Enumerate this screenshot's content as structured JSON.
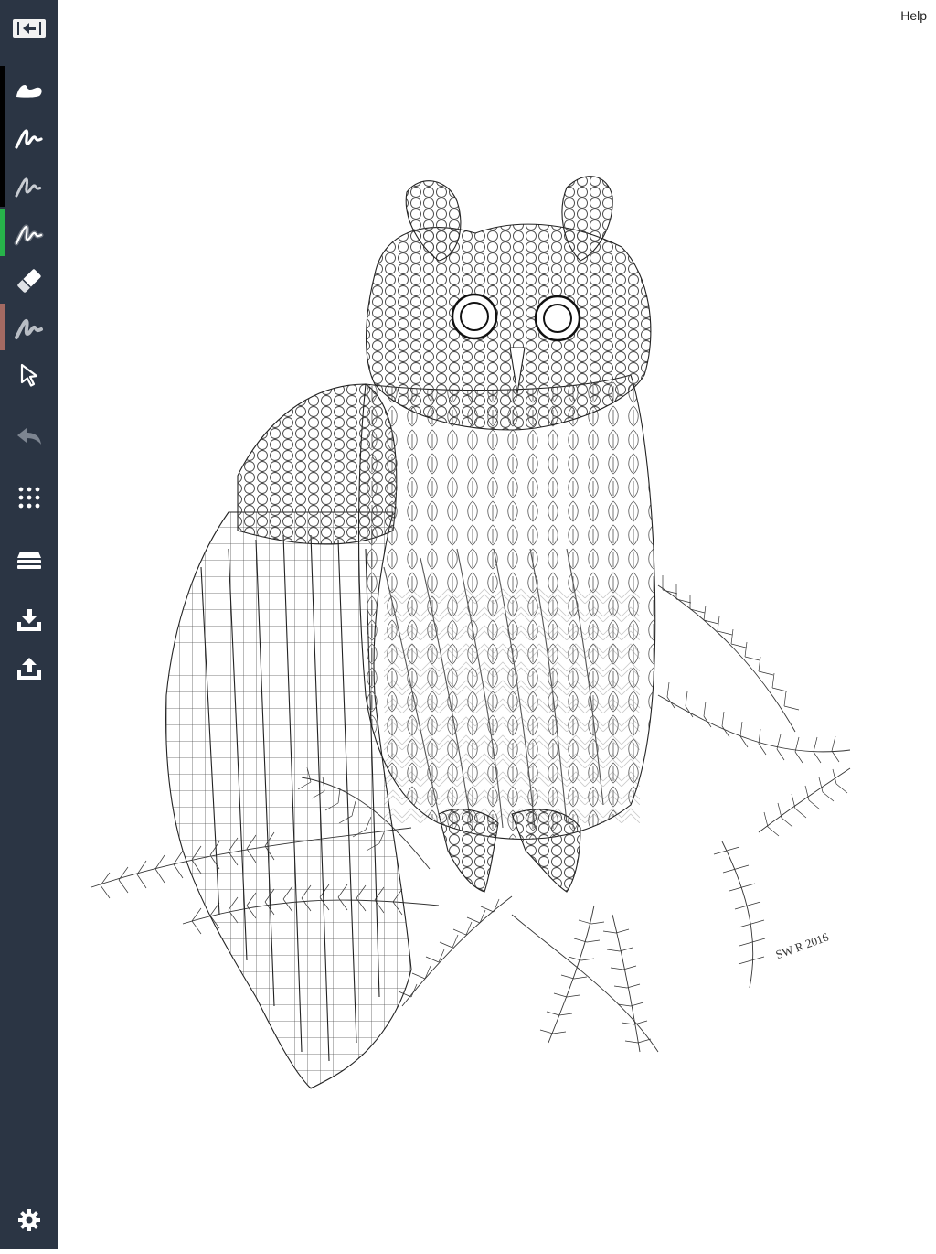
{
  "header": {
    "help_label": "Help"
  },
  "sidebar": {
    "tools": [
      {
        "name": "collapse-toolbar",
        "icon": "panel-collapse-icon"
      },
      {
        "name": "brush-tool",
        "icon": "brush-stroke-icon"
      },
      {
        "name": "pen-tool",
        "icon": "pen-stroke-icon"
      },
      {
        "name": "pencil-tool",
        "icon": "pencil-stroke-icon"
      },
      {
        "name": "airbrush-tool",
        "icon": "airbrush-stroke-icon"
      },
      {
        "name": "eraser-tool",
        "icon": "eraser-icon"
      },
      {
        "name": "smudge-tool",
        "icon": "smudge-stroke-icon"
      },
      {
        "name": "select-tool",
        "icon": "arrow-cursor-icon"
      },
      {
        "name": "undo",
        "icon": "undo-icon"
      },
      {
        "name": "palette-grid",
        "icon": "grid-dots-icon"
      },
      {
        "name": "layers",
        "icon": "layers-icon"
      },
      {
        "name": "import",
        "icon": "download-tray-icon"
      },
      {
        "name": "export",
        "icon": "upload-tray-icon"
      },
      {
        "name": "settings",
        "icon": "gear-icon"
      }
    ],
    "swatches": [
      {
        "color": "#000000"
      },
      {
        "color": "#27b34a"
      },
      {
        "color": "#a46a62"
      }
    ]
  },
  "canvas": {
    "image": "owl-coloring-page",
    "signature": "SW R 2016"
  }
}
